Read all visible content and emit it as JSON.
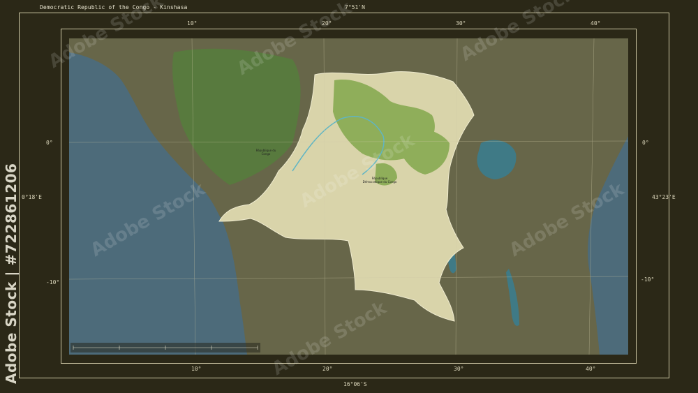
{
  "title": "Democratic Republic of the Congo - Kinshasa",
  "bounds": {
    "north": "7°51'N",
    "south": "16°06'S",
    "west": "0°18'E",
    "east": "43°23'E"
  },
  "ticks": {
    "top": [
      "10°",
      "20°",
      "30°",
      "40°"
    ],
    "bottom": [
      "10°",
      "20°",
      "30°",
      "40°"
    ],
    "left": [
      "0°",
      "-10°"
    ],
    "right": [
      "0°",
      "-10°"
    ]
  },
  "map_labels": {
    "country": "République Démocratique du Congo",
    "neighbor": "République du Congo"
  },
  "watermark": {
    "vertical": "Adobe Stock | #722861206",
    "repeat": "Adobe Stock"
  },
  "colors": {
    "background": "#2b2817",
    "frame": "#cfc9a6",
    "ocean": "#4d6b7a",
    "highlight": "#d9d4aa",
    "forest": "#8fae5a",
    "surroundings": "#676649"
  }
}
